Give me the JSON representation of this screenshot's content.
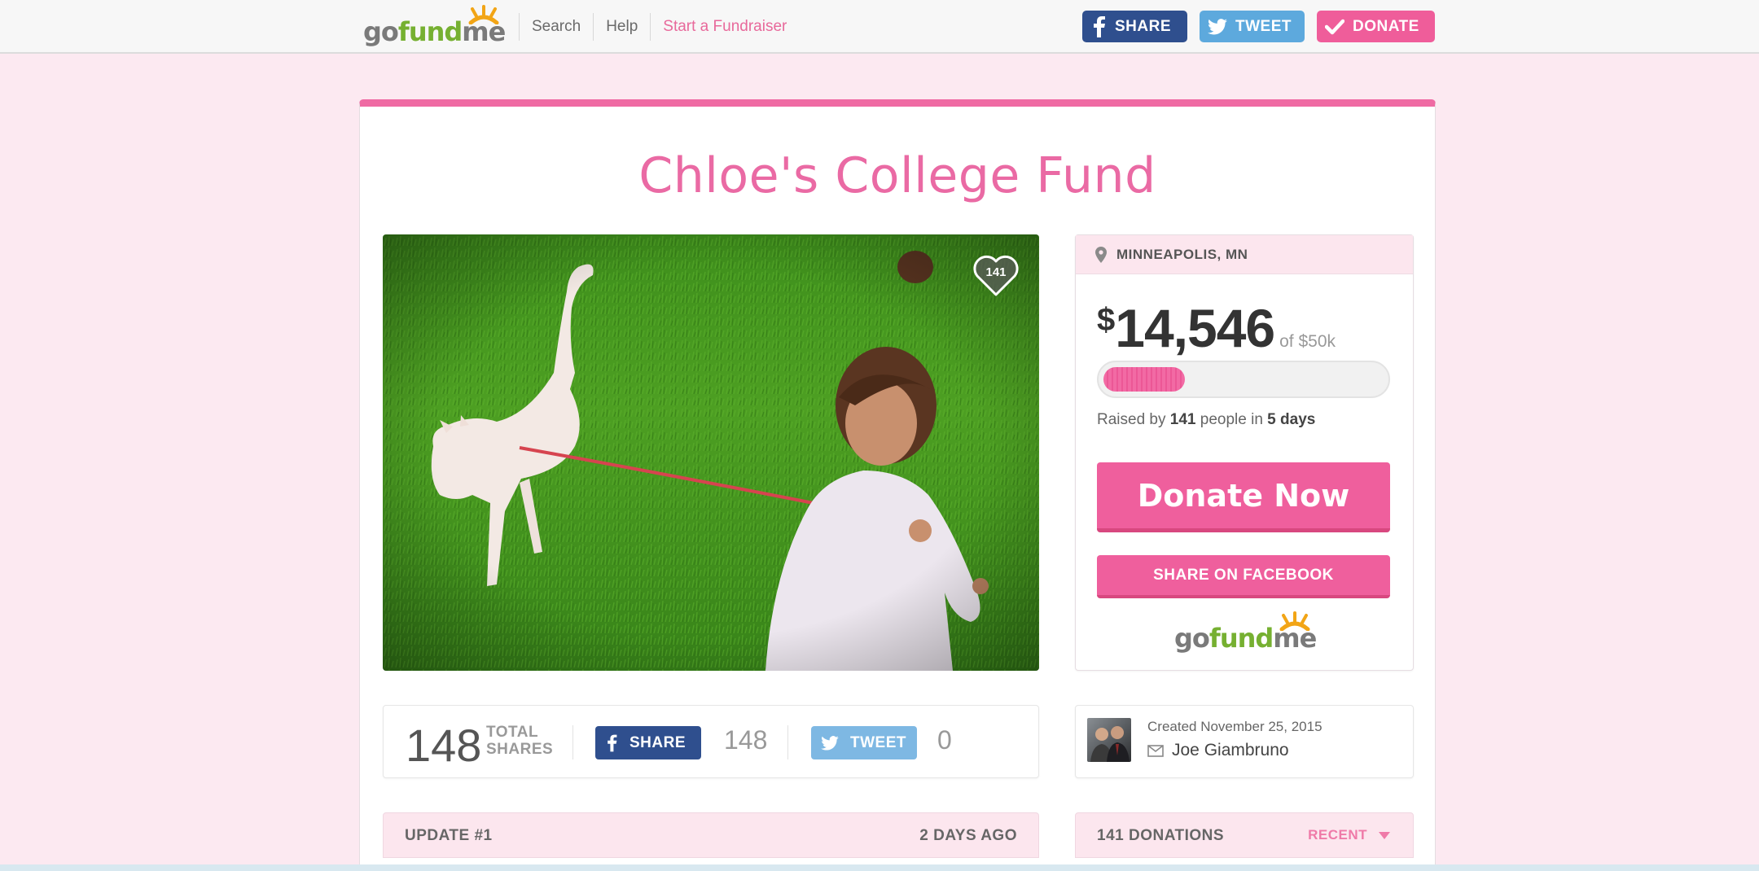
{
  "header": {
    "logo": {
      "go": "go",
      "fund": "fund",
      "me": "me"
    },
    "nav": {
      "search": "Search",
      "help": "Help",
      "start": "Start a Fundraiser"
    },
    "buttons": {
      "share": "SHARE",
      "tweet": "TWEET",
      "donate": "DONATE"
    }
  },
  "campaign": {
    "title": "Chloe's College Fund",
    "favorites": "141",
    "location": "MINNEAPOLIS, MN",
    "currency": "$",
    "raised": "14,546",
    "goal_text": "of $50k",
    "progress_fraction": 0.291,
    "raised_prefix": "Raised by ",
    "people": "141",
    "raised_mid": " people in ",
    "days": "5 days",
    "donate_label": "Donate Now",
    "share_fb_label": "SHARE ON FACEBOOK"
  },
  "shares": {
    "total": "148",
    "total_label_1": "TOTAL",
    "total_label_2": "SHARES",
    "fb_label": "SHARE",
    "fb_count": "148",
    "tw_label": "TWEET",
    "tw_count": "0"
  },
  "creator": {
    "created": "Created November 25, 2015",
    "name": "Joe Giambruno"
  },
  "update": {
    "label": "UPDATE #1",
    "when": "2 DAYS AGO"
  },
  "donations": {
    "label": "141 DONATIONS",
    "sort": "RECENT"
  },
  "colors": {
    "brand_pink": "#ef5f9d",
    "facebook": "#2f4f8e",
    "twitter": "#5da9dd",
    "fund_green": "#76b031"
  }
}
